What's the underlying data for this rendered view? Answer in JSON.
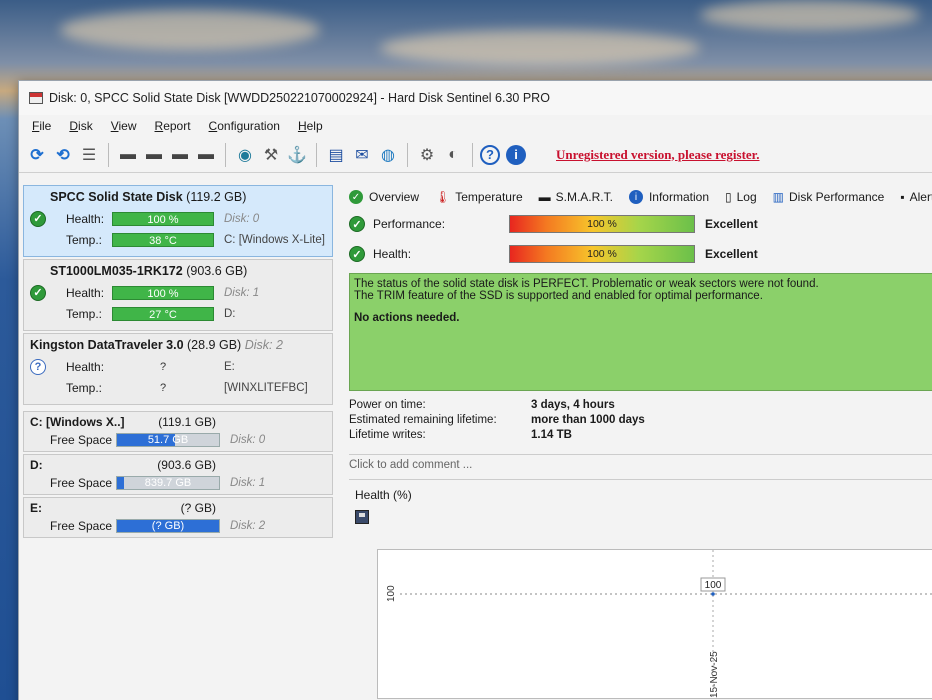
{
  "window": {
    "title": "Disk: 0, SPCC Solid State Disk [WWDD250221070002924]  -  Hard Disk Sentinel 6.30 PRO"
  },
  "menu": [
    "File",
    "Disk",
    "View",
    "Report",
    "Configuration",
    "Help"
  ],
  "toolbar": {
    "icons": [
      "refresh-icon",
      "refresh-all-icon",
      "list-icon",
      "disk-icon",
      "disk-clock-icon",
      "disk-check-icon",
      "disk-test-icon",
      "network-icon",
      "tools-icon",
      "usb-icon",
      "report-icon",
      "mail-icon",
      "world-icon",
      "gear-icon",
      "sound-icon",
      "help-icon",
      "info-icon"
    ],
    "unregistered": "Unregistered version, please register."
  },
  "disks": [
    {
      "name": "SPCC Solid State Disk",
      "size": "(119.2 GB)",
      "disk_label": "",
      "health_label": "Health:",
      "health": "100 %",
      "health_side": "Disk: 0",
      "temp_label": "Temp.:",
      "temp": "38 °C",
      "temp_side": "C: [Windows X-Lite]",
      "status": "ok"
    },
    {
      "name": "ST1000LM035-1RK172",
      "size": "(903.6 GB)",
      "disk_label": "",
      "health_label": "Health:",
      "health": "100 %",
      "health_side": "Disk: 1",
      "temp_label": "Temp.:",
      "temp": "27 °C",
      "temp_side": "D:",
      "status": "ok"
    },
    {
      "name": "Kingston DataTraveler 3.0",
      "size": "(28.9 GB)",
      "disk_label": "Disk: 2",
      "health_label": "Health:",
      "health": "?",
      "health_side": "E:",
      "temp_label": "Temp.:",
      "temp": "?",
      "temp_side": "[WINXLITEFBC]",
      "status": "unknown"
    }
  ],
  "volumes": [
    {
      "name": "C: [Windows X..]",
      "size": "(119.1 GB)",
      "free_label": "Free Space",
      "free": "51.7 GB",
      "used_fraction": 0.57,
      "disk": "Disk: 0"
    },
    {
      "name": "D:",
      "size": "(903.6 GB)",
      "free_label": "Free Space",
      "free": "839.7 GB",
      "used_fraction": 0.07,
      "disk": "Disk: 1"
    },
    {
      "name": "E:",
      "size": "(? GB)",
      "free_label": "Free Space",
      "free": "(? GB)",
      "used_fraction": 1.0,
      "disk": "Disk: 2"
    }
  ],
  "tabs": [
    "Overview",
    "Temperature",
    "S.M.A.R.T.",
    "Information",
    "Log",
    "Disk Performance",
    "Alerts"
  ],
  "overview": {
    "performance_label": "Performance:",
    "performance": "100 %",
    "performance_text": "Excellent",
    "health_label": "Health:",
    "health": "100 %",
    "health_text": "Excellent",
    "status_line1": "The status of the solid state disk is PERFECT. Problematic or weak sectors were not found.",
    "status_line2": "The TRIM feature of the SSD is supported and enabled for optimal performance.",
    "actions": "No actions needed.",
    "power_on_label": "Power on time:",
    "power_on": "3 days, 4 hours",
    "lifetime_label": "Estimated remaining lifetime:",
    "lifetime": "more than 1000 days",
    "writes_label": "Lifetime writes:",
    "writes": "1.14 TB",
    "comment": "Click to add comment ..."
  },
  "chart_data": {
    "type": "line",
    "title": "Health (%)",
    "ylabel": "100",
    "x": [
      "15-Nov-25"
    ],
    "series": [
      {
        "values": [
          100
        ]
      }
    ],
    "data_labels": [
      "100"
    ]
  }
}
